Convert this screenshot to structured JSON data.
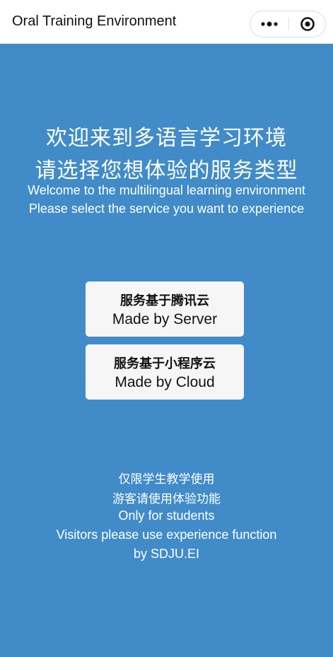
{
  "header": {
    "title": "Oral Training Environment",
    "more_icon": "more-dots-icon",
    "close_icon": "target-close-icon"
  },
  "welcome": {
    "zh_line1": "欢迎来到多语言学习环境",
    "zh_line2": "请选择您想体验的服务类型",
    "en_line1": "Welcome to the multilingual learning environment",
    "en_line2": "Please select the service you want to experience"
  },
  "buttons": [
    {
      "zh": "服务基于腾讯云",
      "en": "Made by Server"
    },
    {
      "zh": "服务基于小程序云",
      "en": "Made by Cloud"
    }
  ],
  "footer": {
    "zh_line1": "仅限学生教学使用",
    "zh_line2": "游客请使用体验功能",
    "en_line1": "Only for students",
    "en_line2": "Visitors please use experience function",
    "credit": "by SDJU.EI"
  },
  "colors": {
    "background": "#418bc8",
    "button_bg": "#f6f6f6",
    "text_light": "#ffffff"
  }
}
